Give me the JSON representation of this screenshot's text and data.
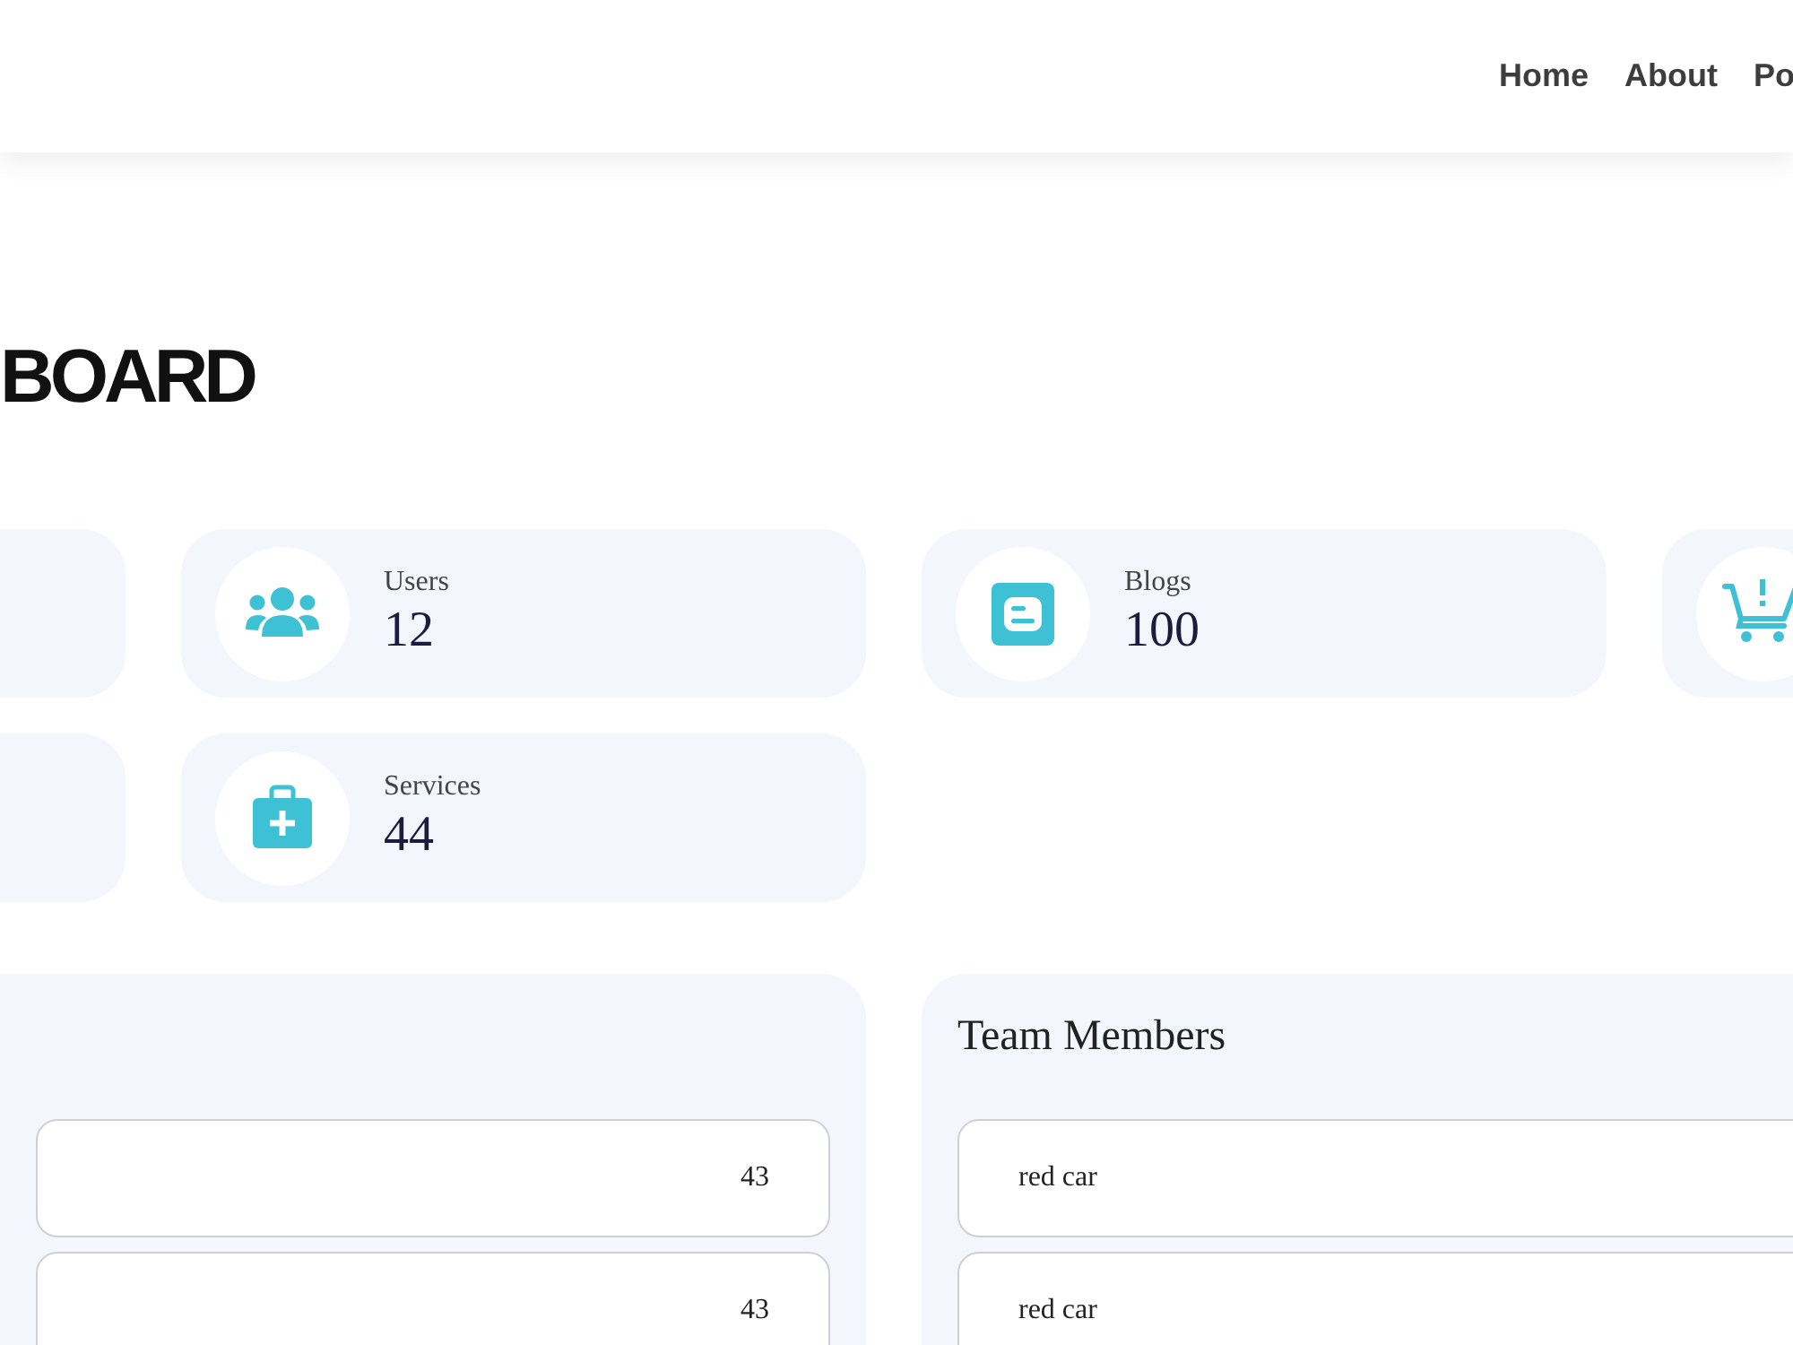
{
  "nav": {
    "links": [
      {
        "label": "Home"
      },
      {
        "label": "About"
      },
      {
        "label": "Po"
      }
    ]
  },
  "page_title": "BOARD",
  "stat_cards": [
    {
      "kind": "users",
      "label": "Users",
      "value": "12"
    },
    {
      "kind": "blogs",
      "label": "Blogs",
      "value": "100"
    },
    {
      "kind": "cart"
    },
    {
      "kind": "services",
      "label": "Services",
      "value": "44"
    }
  ],
  "panels": [
    {
      "items": [
        {
          "value": "43"
        },
        {
          "value": "43"
        }
      ]
    },
    {
      "title": "Team Members",
      "items": [
        {
          "name": "red car"
        },
        {
          "name": "red car"
        }
      ]
    }
  ]
}
